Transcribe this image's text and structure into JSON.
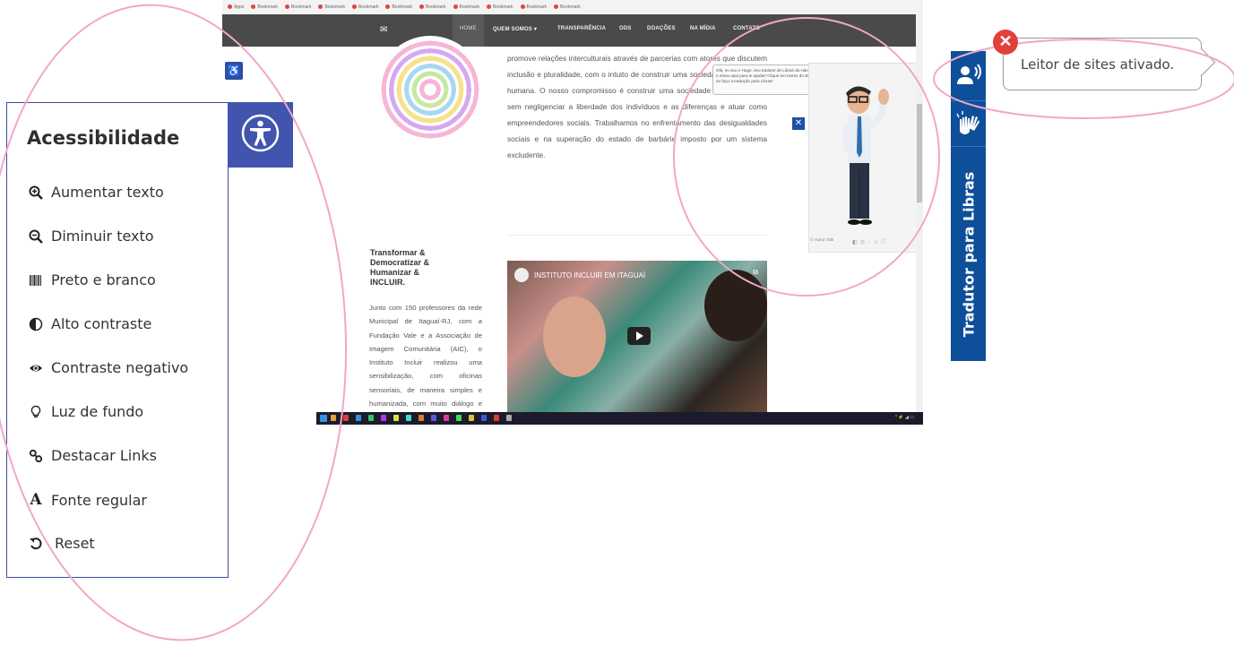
{
  "browser": {
    "nav": {
      "items": [
        "HOME",
        "QUEM SOMOS ▾",
        "TRANSPARÊNCIA",
        "ODS",
        "DOAÇÕES",
        "NA MÍDIA",
        "CONTATO"
      ]
    },
    "paragraph": "promove relações interculturais através de parcerias com atores que discutem inclusão e pluralidade, com o intuito de construir uma sociedade mais justa e humana. O nosso compromisso é construir uma sociedade mais igualitária, sem negligenciar a liberdade dos indivíduos e as diferenças e atuar como empreendedores sociais. Trabalhamos no enfrentamento das desigualdades sociais e na superação do estado de barbárie imposto por um sistema excludente.",
    "section_title": "Transformar & Democratizar & Humanizar & INCLUIR.",
    "section_text": "Junto com 150 professores da rede Municipal de Itaguaí-RJ, com a Fundação Vale e a Associação de Imagem Comunitária (AIC), o Instituto Incluir realizou uma sensibilização, com oficinas sensoriais, de maneira simples e humanizada, com muito diálogo e com foco nos professores. Pela",
    "video": {
      "title": "INSTITUTO INCLUIR EM ITAGUAÍ"
    },
    "hand_talk": {
      "bubble": "Olá, eu sou o Hugo, seu tradutor de Libras da Hand Talk e estou aqui para te ajudar! Clique em textos do site que eu faço a tradução para Libras!",
      "footer": "© Hand Talk"
    }
  },
  "accessibility": {
    "title": "Acessibilidade",
    "toggle_icon": "accessibility-person-icon",
    "items": [
      {
        "label": "Aumentar texto",
        "icon": "zoom-in-icon"
      },
      {
        "label": "Diminuir texto",
        "icon": "zoom-out-icon"
      },
      {
        "label": "Preto e branco",
        "icon": "barcode-icon"
      },
      {
        "label": "Alto contraste",
        "icon": "half-circle-icon"
      },
      {
        "label": "Contraste negativo",
        "icon": "eye-icon"
      },
      {
        "label": "Luz de fundo",
        "icon": "lightbulb-icon"
      },
      {
        "label": "Destacar Links",
        "icon": "link-icon"
      },
      {
        "label": "Fonte regular",
        "icon": "font-icon"
      },
      {
        "label": "Reset",
        "icon": "reset-icon"
      }
    ]
  },
  "libras": {
    "label": "Tradutor para Libras",
    "icons": [
      "speaking-person-icon",
      "sign-language-hands-icon"
    ]
  },
  "toast": {
    "text": "Leitor de sites ativado.",
    "close_icon": "close-icon"
  },
  "colors": {
    "panel_blue": "#4154ae",
    "libras_blue": "#0d4f9a",
    "annotation_pink": "#f2a7c8",
    "close_red": "#e2403a"
  }
}
